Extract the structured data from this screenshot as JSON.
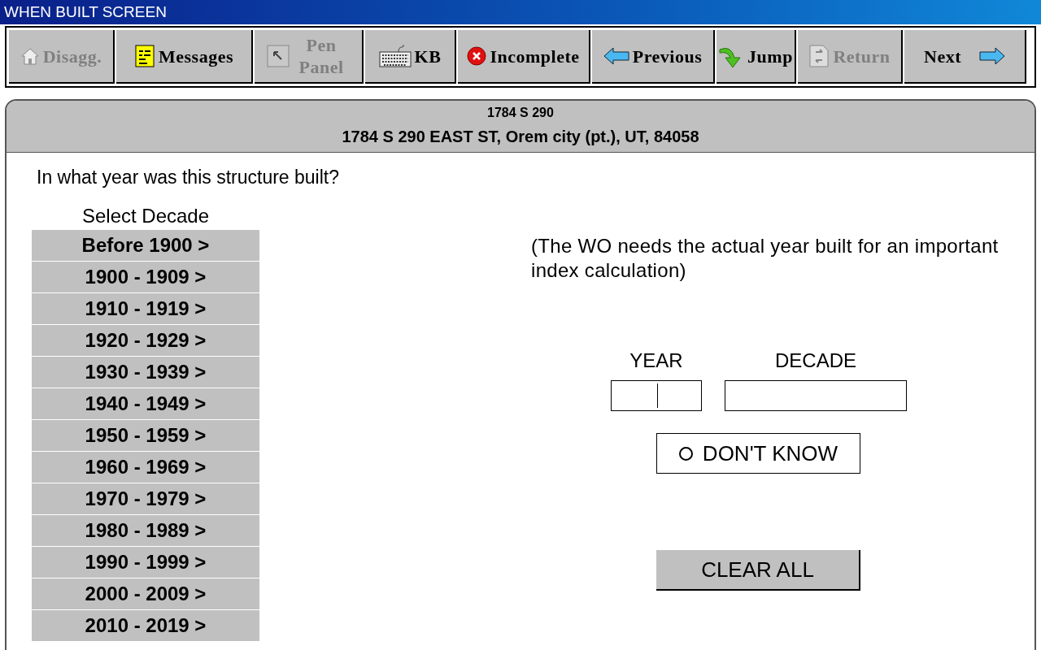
{
  "window": {
    "title": "WHEN BUILT SCREEN"
  },
  "toolbar": [
    {
      "kind": "house",
      "label": "Disagg.",
      "disabled": true
    },
    {
      "kind": "notepad",
      "label": "Messages",
      "disabled": false
    },
    {
      "kind": "pointer",
      "label": "Pen Panel",
      "disabled": true
    },
    {
      "kind": "keyboard",
      "label": "KB",
      "disabled": false
    },
    {
      "kind": "error",
      "label": "Incomplete",
      "disabled": false
    },
    {
      "kind": "back",
      "label": "Previous",
      "disabled": false
    },
    {
      "kind": "jump",
      "label": "Jump",
      "disabled": false
    },
    {
      "kind": "return",
      "label": "Return",
      "disabled": true
    },
    {
      "kind": "next",
      "label": "Next",
      "disabled": false
    }
  ],
  "header": {
    "short_address": "1784 S 290",
    "full_address": "1784 S 290 EAST ST, Orem city (pt.), UT, 84058"
  },
  "question": "In what year was this structure built?",
  "decades": {
    "title": "Select Decade",
    "items": [
      "Before 1900 >",
      "1900 - 1909 >",
      "1910 - 1919 >",
      "1920 - 1929 >",
      "1930 - 1939 >",
      "1940 - 1949 >",
      "1950 - 1959 >",
      "1960 - 1969 >",
      "1970 - 1979 >",
      "1980 - 1989 >",
      "1990 - 1999 >",
      "2000 - 2009 >",
      "2010 - 2019 >"
    ]
  },
  "note": "(The WO needs the actual year built for an important index calculation)",
  "year_field": {
    "label": "YEAR",
    "focused": true
  },
  "decade_field": {
    "label": "DECADE"
  },
  "dont_know": {
    "label": "DON'T KNOW",
    "checked": false
  },
  "clear_button": "CLEAR ALL"
}
